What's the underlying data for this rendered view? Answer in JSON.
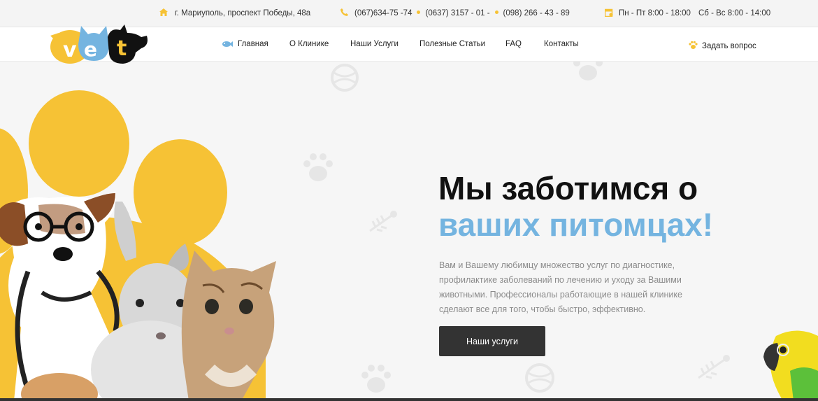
{
  "topbar": {
    "address": "г. Мариуполь, проспект Победы, 48а",
    "phone1": "(067)634-75 -74",
    "phone2": "(0637) 3157 - 01 -",
    "phone3": "(098) 266 - 43 - 89",
    "hours_weekdays": "Пн - Пт 8:00 - 18:00",
    "hours_weekend": "Сб - Вс 8:00 - 14:00"
  },
  "logo": {
    "text": "vet"
  },
  "nav": {
    "items": [
      "Главная",
      "О Клинике",
      "Наши Услуги",
      "Полезные Статьи",
      "FAQ",
      "Контакты"
    ],
    "ask_label": "Задать вопрос"
  },
  "hero": {
    "title_line1": "Мы заботимся о",
    "title_line2": "ваших питомцах!",
    "description": "Вам и Вашему любимцу множество услуг по диагностике, профилактике заболеваний по лечению и уходу за Вашими животными. Профессионалы работающие в нашей клинике сделают все для того, чтобы быстро, эффективно.",
    "button_label": "Наши услуги"
  },
  "colors": {
    "accent_yellow": "#f6c235",
    "accent_blue": "#74b4e0",
    "button_dark": "#333333"
  }
}
